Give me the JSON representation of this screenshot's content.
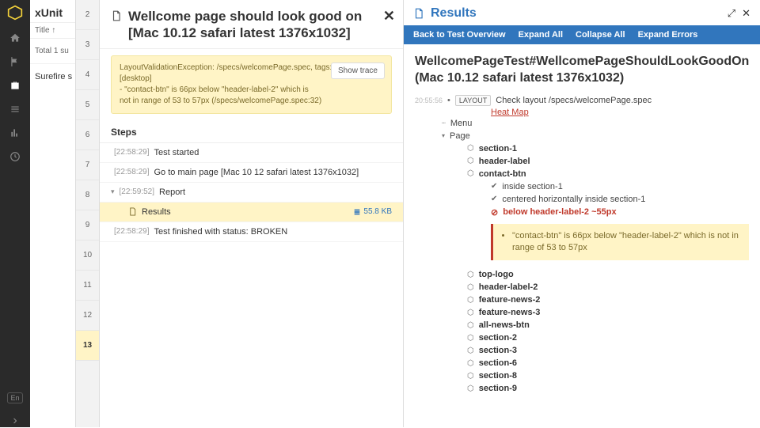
{
  "iconbar": {
    "lang": "En",
    "arrow": "›"
  },
  "suite": {
    "title": "xUnit",
    "sort_label": "Title ↑",
    "total_label": "Total 1 su",
    "suite_name": "Surefire s"
  },
  "numbers": [
    "2",
    "3",
    "4",
    "5",
    "6",
    "7",
    "8",
    "9",
    "10",
    "11",
    "12",
    "13"
  ],
  "main": {
    "title": "Wellcome page should look good on [Mac 10.12 safari latest 1376x1032]",
    "exception_l1": "LayoutValidationException: /specs/welcomePage.spec, tags:",
    "exception_l2": "[desktop]",
    "exception_l3": "  - \"contact-btn\" is 66px below \"header-label-2\" which is",
    "exception_l4": "not in range of 53 to 57px (/specs/welcomePage.spec:32)",
    "show_trace_label": "Show trace",
    "steps_header": "Steps",
    "steps": {
      "s1_ts": "[22:58:29]",
      "s1_txt": "Test started",
      "s2_ts": "[22:58:29]",
      "s2_txt": "Go to main page [Mac 10 12 safari latest 1376x1032]",
      "s3_ts": "[22:59:52]",
      "s3_txt": "Report",
      "s4_txt": "Results",
      "s4_size": "55.8 KB",
      "s5_ts": "[22:58:29]",
      "s5_txt": "Test finished with status: BROKEN"
    }
  },
  "results": {
    "panel_title": "Results",
    "toolbar": {
      "back": "Back to Test Overview",
      "expand_all": "Expand All",
      "collapse_all": "Collapse All",
      "expand_errors": "Expand Errors"
    },
    "heading": "WellcomePageTest#WellcomePageShouldLookGoodOn (Mac 10.12 safari latest 1376x1032)",
    "timestamp": "20:55:56",
    "layout_tag": "LAYOUT",
    "layout_text": "Check layout /specs/welcomePage.spec",
    "heatmap": "Heat Map",
    "nodes": {
      "menu": "Menu",
      "page": "Page",
      "section1": "section-1",
      "headerlabel": "header-label",
      "contactbtn": "contact-btn",
      "chk1": "inside section-1",
      "chk2": "centered horizontally inside section-1",
      "errline": "below header-label-2 ~55px",
      "errbox_text": "\"contact-btn\" is 66px below \"header-label-2\" which is not in range of 53 to 57px",
      "n1": "top-logo",
      "n2": "header-label-2",
      "n3": "feature-news-2",
      "n4": "feature-news-3",
      "n5": "all-news-btn",
      "n6": "section-2",
      "n7": "section-3",
      "n8": "section-6",
      "n9": "section-8",
      "n10": "section-9"
    }
  }
}
